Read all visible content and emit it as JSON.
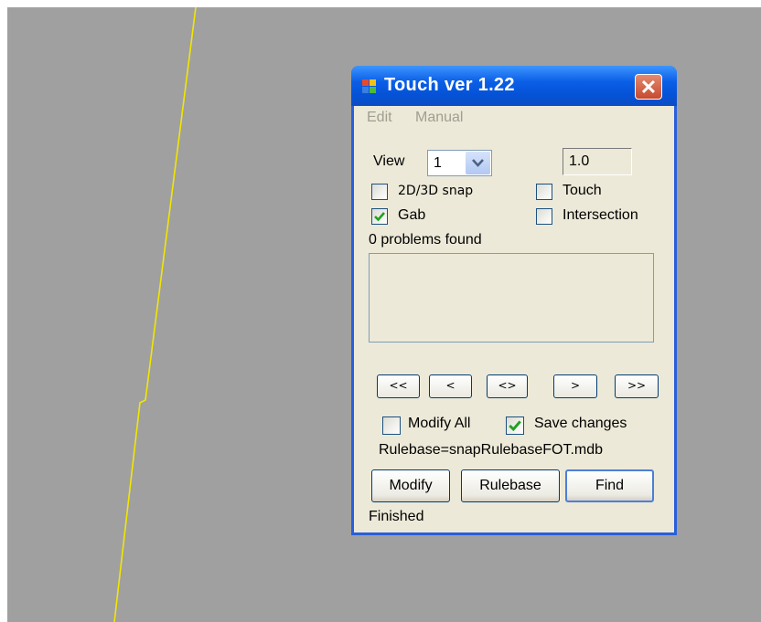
{
  "window": {
    "title": "Touch ver 1.22",
    "close_glyph": "✕",
    "icon": "app-window-icon"
  },
  "menu": {
    "items": [
      "Edit",
      "Manual"
    ]
  },
  "view": {
    "label": "View",
    "selected": "1",
    "value": "1.0"
  },
  "options": {
    "snap_label": "2D/3D snap",
    "snap_checked": false,
    "touch_label": "Touch",
    "touch_checked": false,
    "gab_label": "Gab",
    "gab_checked": true,
    "intersection_label": "Intersection",
    "intersection_checked": false
  },
  "problems_text": "0 problems found",
  "nav": {
    "first": "<<",
    "prev": "<",
    "center": "<>",
    "next": ">",
    "last": ">>"
  },
  "modify_all": {
    "label": "Modify All",
    "checked": false
  },
  "save_changes": {
    "label": "Save changes",
    "checked": true
  },
  "rulebase_text": "Rulebase=snapRulebaseFOT.mdb",
  "buttons": {
    "modify": "Modify",
    "rulebase": "Rulebase",
    "find": "Find"
  },
  "status": "Finished",
  "colors": {
    "canvas": "#a0a0a0",
    "line": "#f2e600",
    "window_face": "#ece9d8",
    "titlebar": "#0553d8",
    "check": "#21a121"
  }
}
